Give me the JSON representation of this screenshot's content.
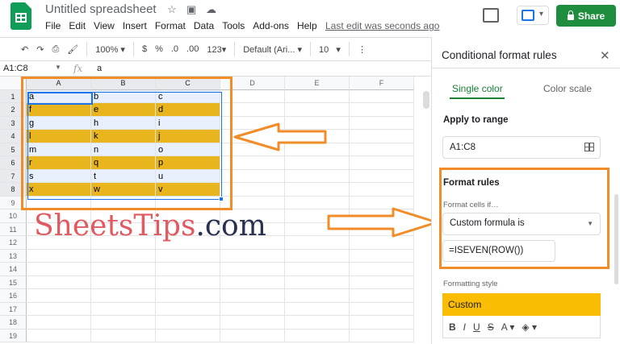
{
  "header": {
    "doc_title": "Untitled spreadsheet",
    "menu": [
      "File",
      "Edit",
      "View",
      "Insert",
      "Format",
      "Data",
      "Tools",
      "Add-ons",
      "Help"
    ],
    "last_edit": "Last edit was seconds ago",
    "share_label": "Share"
  },
  "toolbar": {
    "zoom": "100%",
    "currency": "$",
    "percent": "%",
    "dec_decrease": ".0",
    "dec_increase": ".00",
    "more_formats": "123",
    "font": "Default (Ari...",
    "font_size": "10",
    "more": "⋮"
  },
  "formula_bar": {
    "name_box": "A1:C8",
    "fx": "fx",
    "value": "a"
  },
  "grid": {
    "columns": [
      "A",
      "B",
      "C",
      "D",
      "E",
      "F"
    ],
    "rows": [
      {
        "n": "1",
        "cells": [
          "a",
          "b",
          "c"
        ],
        "style": "blue"
      },
      {
        "n": "2",
        "cells": [
          "f",
          "e",
          "d"
        ],
        "style": "gold"
      },
      {
        "n": "3",
        "cells": [
          "g",
          "h",
          "i"
        ],
        "style": "blue"
      },
      {
        "n": "4",
        "cells": [
          "l",
          "k",
          "j"
        ],
        "style": "gold"
      },
      {
        "n": "5",
        "cells": [
          "m",
          "n",
          "o"
        ],
        "style": "blue"
      },
      {
        "n": "6",
        "cells": [
          "r",
          "q",
          "p"
        ],
        "style": "gold"
      },
      {
        "n": "7",
        "cells": [
          "s",
          "t",
          "u"
        ],
        "style": "blue"
      },
      {
        "n": "8",
        "cells": [
          "x",
          "w",
          "v"
        ],
        "style": "gold"
      },
      {
        "n": "9",
        "cells": [
          "",
          "",
          ""
        ],
        "style": ""
      },
      {
        "n": "10",
        "cells": [
          "",
          "",
          ""
        ],
        "style": ""
      },
      {
        "n": "11",
        "cells": [
          "",
          "",
          ""
        ],
        "style": ""
      },
      {
        "n": "12",
        "cells": [
          "",
          "",
          ""
        ],
        "style": ""
      },
      {
        "n": "13",
        "cells": [
          "",
          "",
          ""
        ],
        "style": ""
      },
      {
        "n": "14",
        "cells": [
          "",
          "",
          ""
        ],
        "style": ""
      },
      {
        "n": "15",
        "cells": [
          "",
          "",
          ""
        ],
        "style": ""
      },
      {
        "n": "16",
        "cells": [
          "",
          "",
          ""
        ],
        "style": ""
      },
      {
        "n": "17",
        "cells": [
          "",
          "",
          ""
        ],
        "style": ""
      },
      {
        "n": "18",
        "cells": [
          "",
          "",
          ""
        ],
        "style": ""
      },
      {
        "n": "19",
        "cells": [
          "",
          "",
          ""
        ],
        "style": ""
      }
    ]
  },
  "watermark": {
    "part1": "Sheets",
    "part2": "Tips",
    "part3": ".com"
  },
  "panel": {
    "title": "Conditional format rules",
    "tab_single": "Single color",
    "tab_scale": "Color scale",
    "apply_label": "Apply to range",
    "range_value": "A1:C8",
    "rules_label": "Format rules",
    "cells_if_label": "Format cells if…",
    "condition": "Custom formula is",
    "formula": "=ISEVEN(ROW())",
    "style_label": "Formatting style",
    "style_preview": "Custom",
    "style_tools": [
      "B",
      "I",
      "U",
      "S",
      "A",
      "◈"
    ]
  },
  "colors": {
    "highlight": "#e8b51e",
    "selection": "#e8f0fe",
    "annotation": "#f28c28",
    "share_green": "#1e8e3e",
    "tab_green": "#188038",
    "custom_fill": "#fbbc04"
  }
}
